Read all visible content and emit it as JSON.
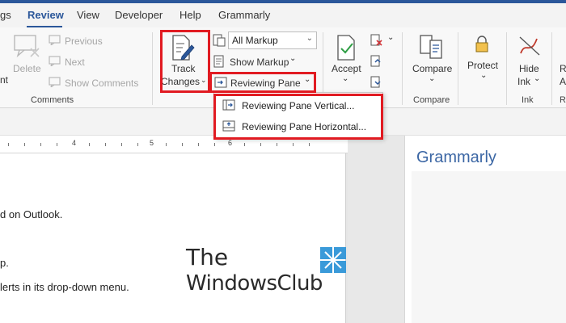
{
  "menubar": {
    "tabs": [
      {
        "label": "gs"
      },
      {
        "label": "Review"
      },
      {
        "label": "View"
      },
      {
        "label": "Developer"
      },
      {
        "label": "Help"
      },
      {
        "label": "Grammarly"
      }
    ],
    "active_tab": "Review"
  },
  "comments_group": {
    "partial_left": "nt",
    "delete": "Delete",
    "previous": "Previous",
    "next": "Next",
    "show_comments": "Show Comments",
    "label": "Comments"
  },
  "tracking_group": {
    "track_changes_line1": "Track",
    "track_changes_line2": "Changes",
    "markup_select": "All Markup",
    "show_markup": "Show Markup",
    "reviewing_pane": "Reviewing Pane"
  },
  "changes_group": {
    "accept": "Accept"
  },
  "compare_group": {
    "compare": "Compare",
    "label": "Compare"
  },
  "protect_group": {
    "protect": "Protect"
  },
  "ink_group": {
    "hide_ink_line1": "Hide",
    "hide_ink_line2": "Ink",
    "label": "Ink",
    "partial_right_top": "R",
    "partial_right_mid": "A",
    "partial_right_bottom": "R"
  },
  "reviewing_pane_menu": {
    "vertical": "Reviewing Pane Vertical...",
    "horizontal": "Reviewing Pane Horizontal..."
  },
  "ruler": {
    "numbers": [
      "4",
      "5",
      "6"
    ]
  },
  "document": {
    "lines": [
      "d on Outlook.",
      "p.",
      "lerts in its drop-down menu."
    ]
  },
  "grammarly_panel": {
    "title": "Grammarly"
  },
  "watermark": {
    "line1": "The",
    "line2": "WindowsClub"
  },
  "colors": {
    "accent": "#2b579a",
    "highlight": "#e11b22",
    "grammarly_blue": "#3b66a4"
  }
}
